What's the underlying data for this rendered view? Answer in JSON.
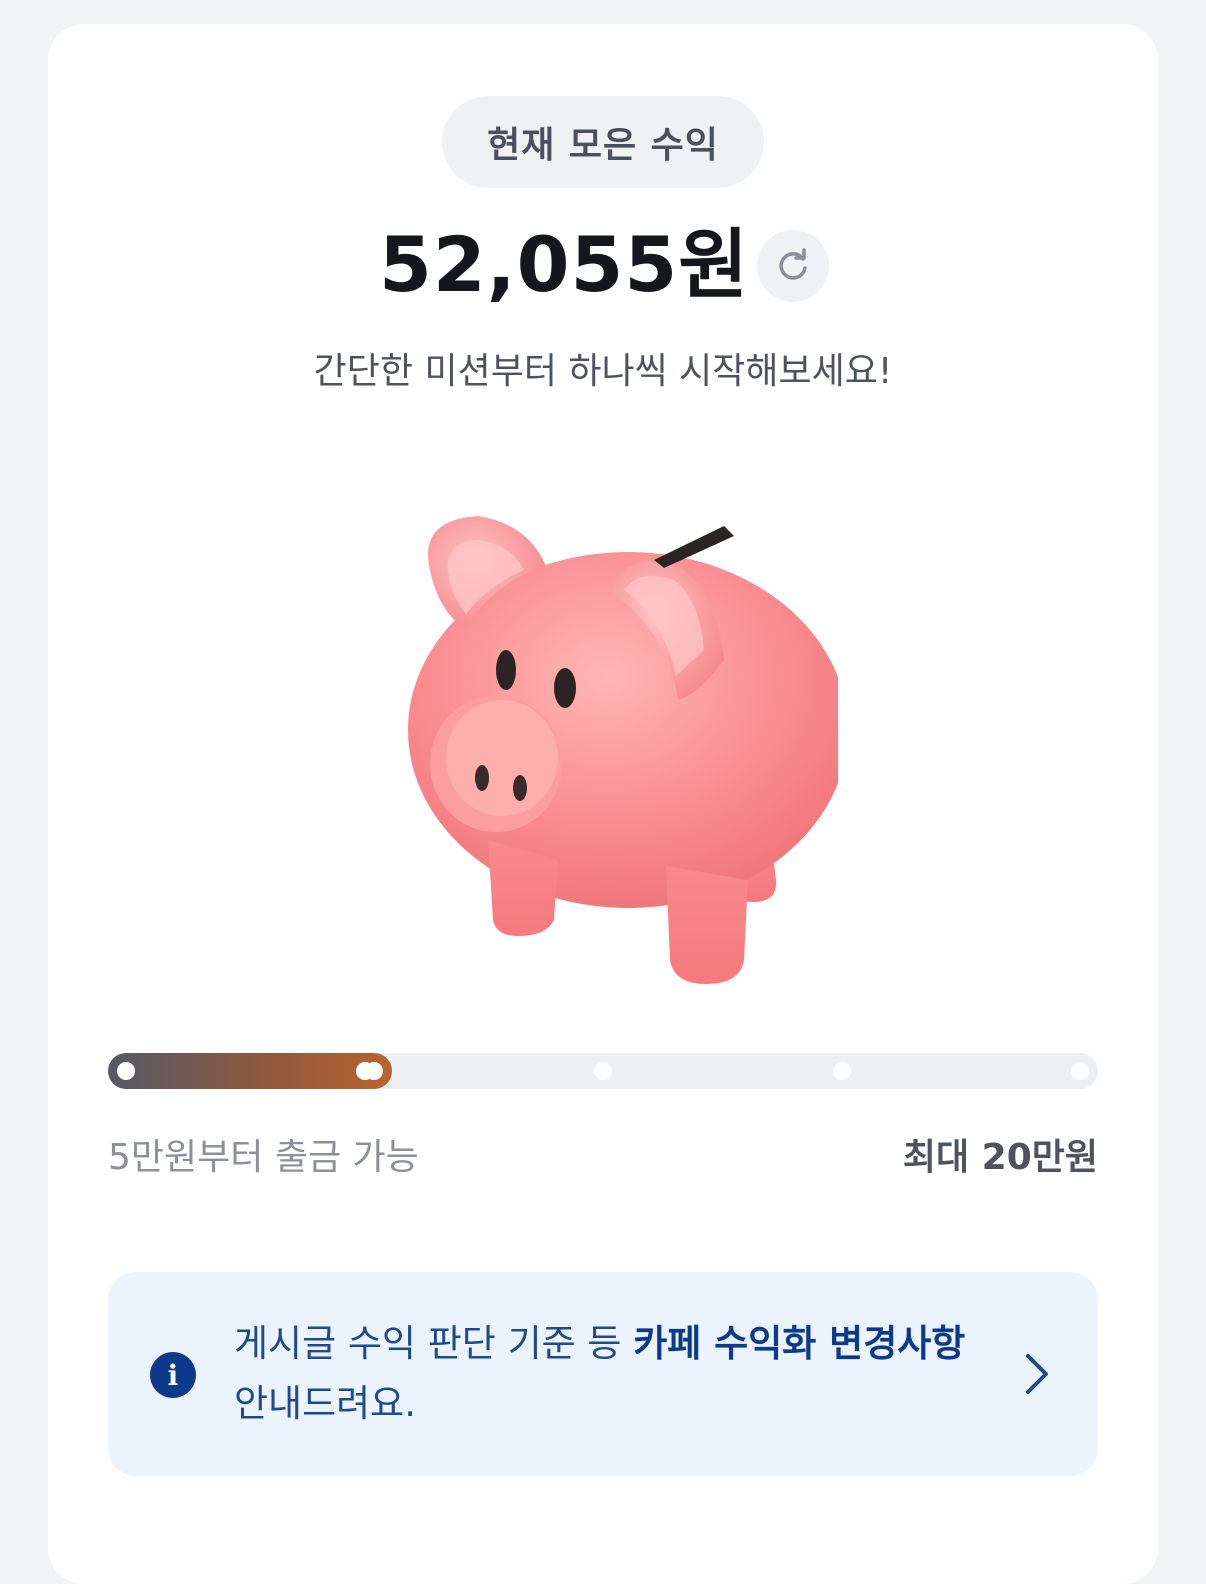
{
  "header": {
    "pill_label": "현재 모은 수익",
    "amount": "52,055원",
    "subtitle": "간단한 미션부터 하나씩 시작해보세요!"
  },
  "icons": {
    "refresh": "refresh-icon",
    "piggy_bank": "piggy-bank-illustration",
    "info": "info-icon",
    "chevron": "chevron-right-icon"
  },
  "progress": {
    "current_value": 52055,
    "max_value": 200000,
    "stop_count": 5,
    "min_label": "5만원부터 출금 가능",
    "max_label": "최대 20만원",
    "fill_colors": [
      "#545a68",
      "#b8642c"
    ]
  },
  "notice": {
    "text_before": "게시글 수익 판단 기준 등 ",
    "text_bold": "카페 수익화 변경사항",
    "text_after": " 안내드려요.",
    "info_glyph": "i"
  },
  "colors": {
    "background": "#f2f3f5",
    "card": "#ffffff",
    "notice_bg": "#ebf3fc",
    "accent_navy": "#0d3a8c",
    "pig_pink": "#f88a8e"
  }
}
